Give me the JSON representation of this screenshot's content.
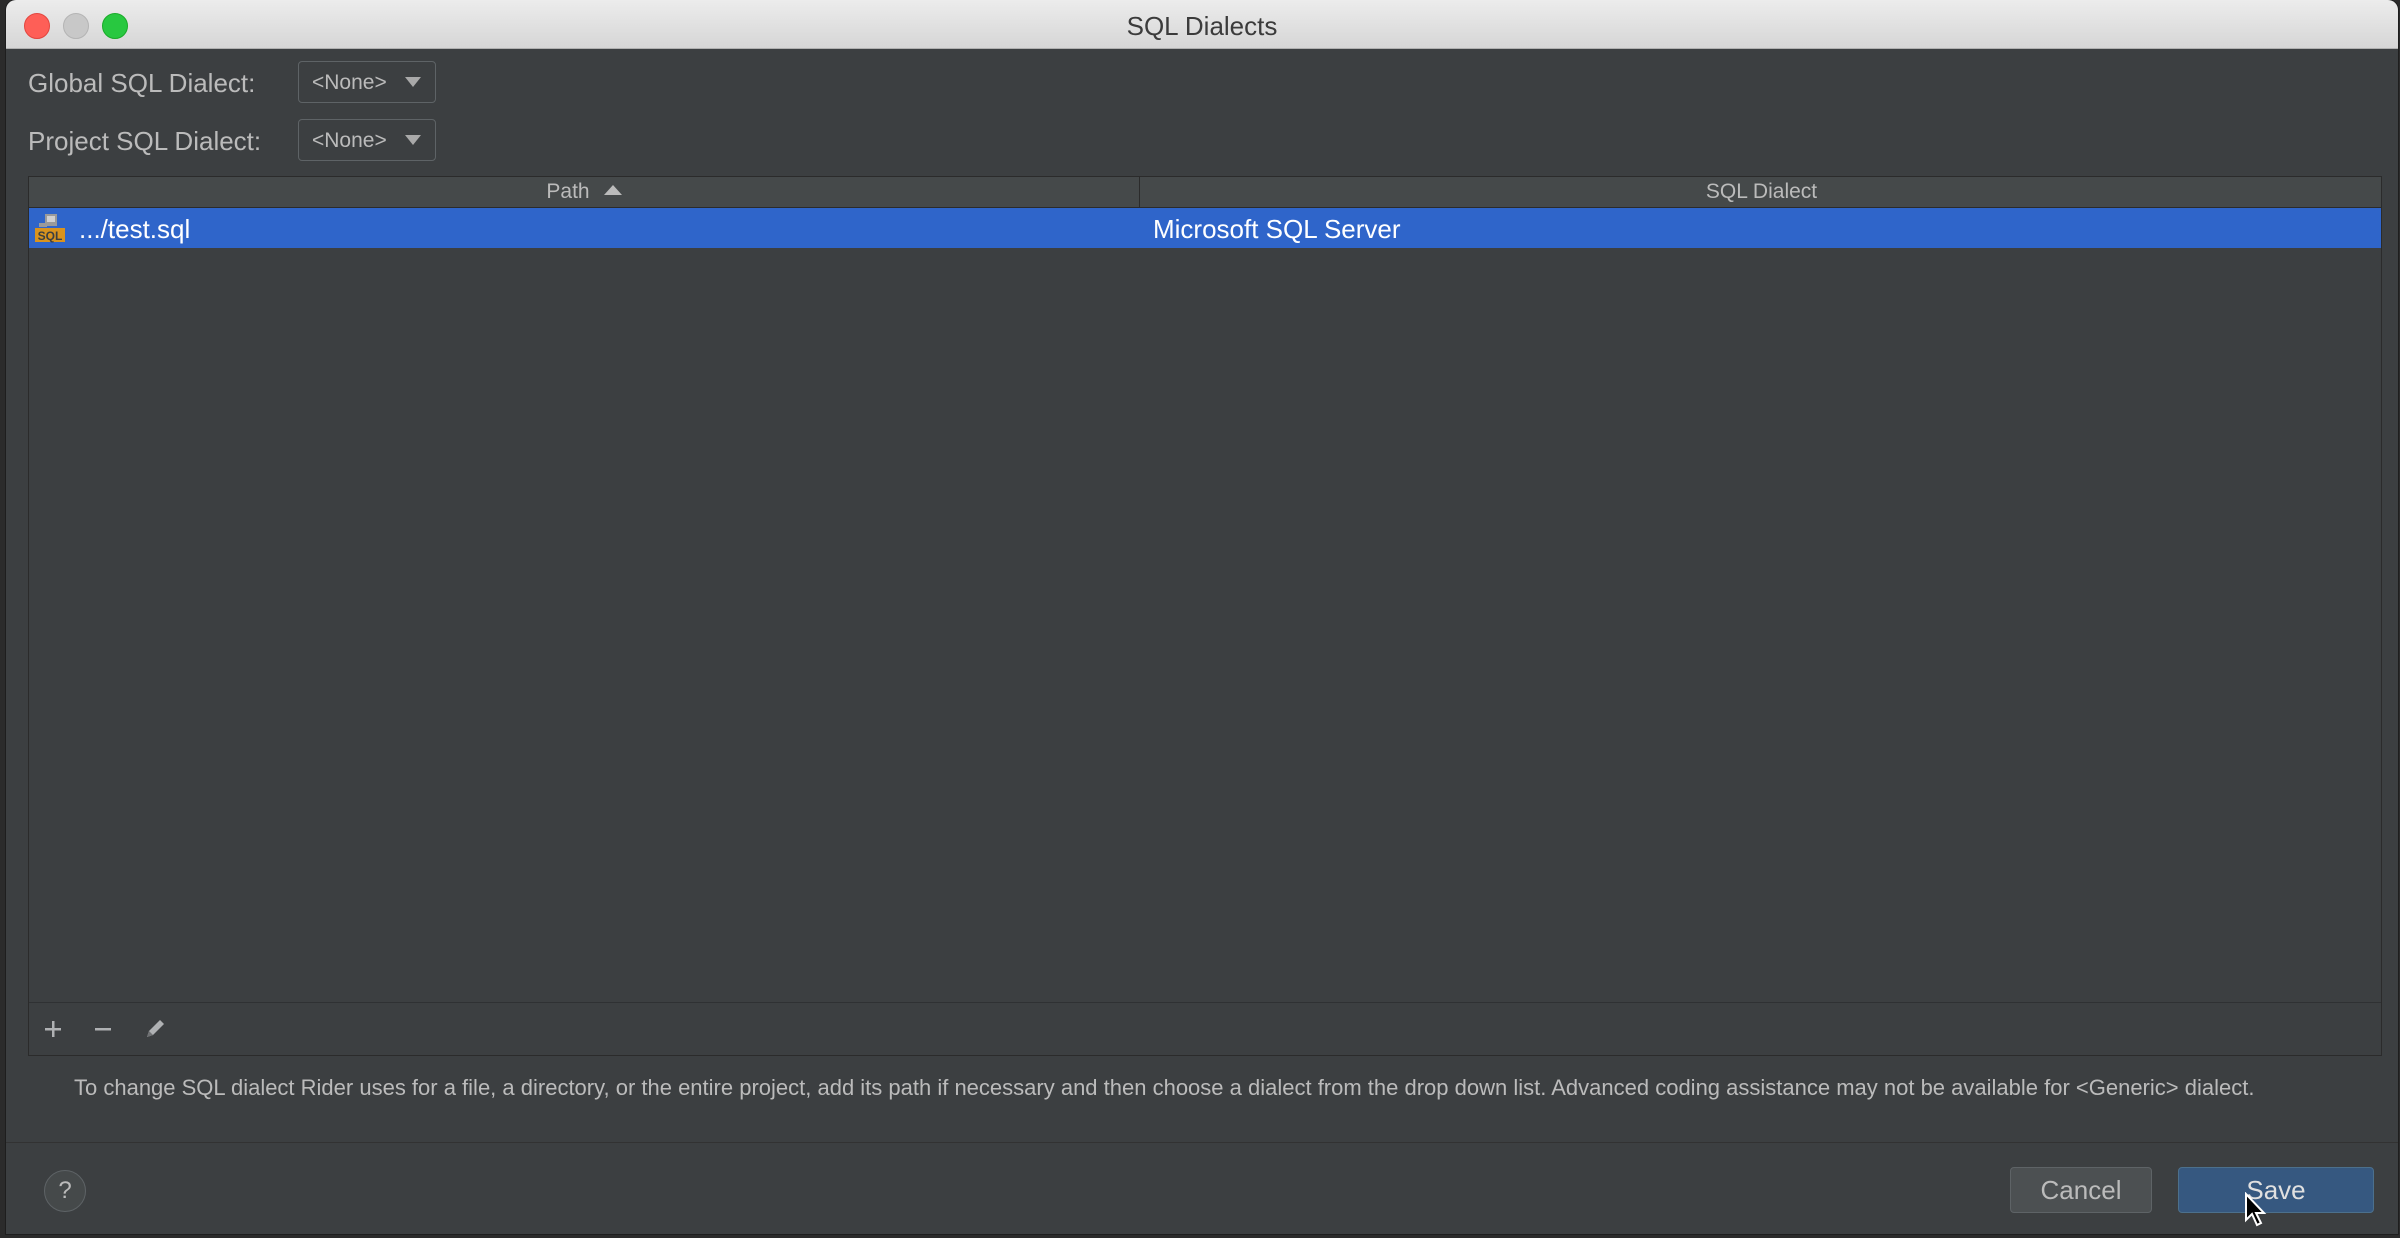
{
  "window": {
    "title": "SQL Dialects"
  },
  "settings": {
    "global_label": "Global SQL Dialect:",
    "global_value": "<None>",
    "project_label": "Project SQL Dialect:",
    "project_value": "<None>"
  },
  "table": {
    "columns": [
      "Path",
      "SQL Dialect"
    ],
    "sort_column": "Path",
    "sort_direction": "ascending",
    "rows": [
      {
        "icon": "sql-file-icon",
        "icon_text": "SQL",
        "path": ".../test.sql",
        "dialect": "Microsoft SQL Server",
        "selected": true
      }
    ]
  },
  "toolbar": {
    "add": "add-icon",
    "remove": "remove-icon",
    "edit": "edit-icon"
  },
  "hint": "To change SQL dialect Rider uses for a file, a directory, or the entire project, add its path if necessary and then choose a dialect from the drop down list. Advanced coding assistance may not be available for <Generic> dialect.",
  "footer": {
    "help": "?",
    "cancel": "Cancel",
    "save": "Save"
  },
  "colors": {
    "selection": "#2f65ca",
    "background": "#3c3f41",
    "primary_button": "#365880"
  }
}
